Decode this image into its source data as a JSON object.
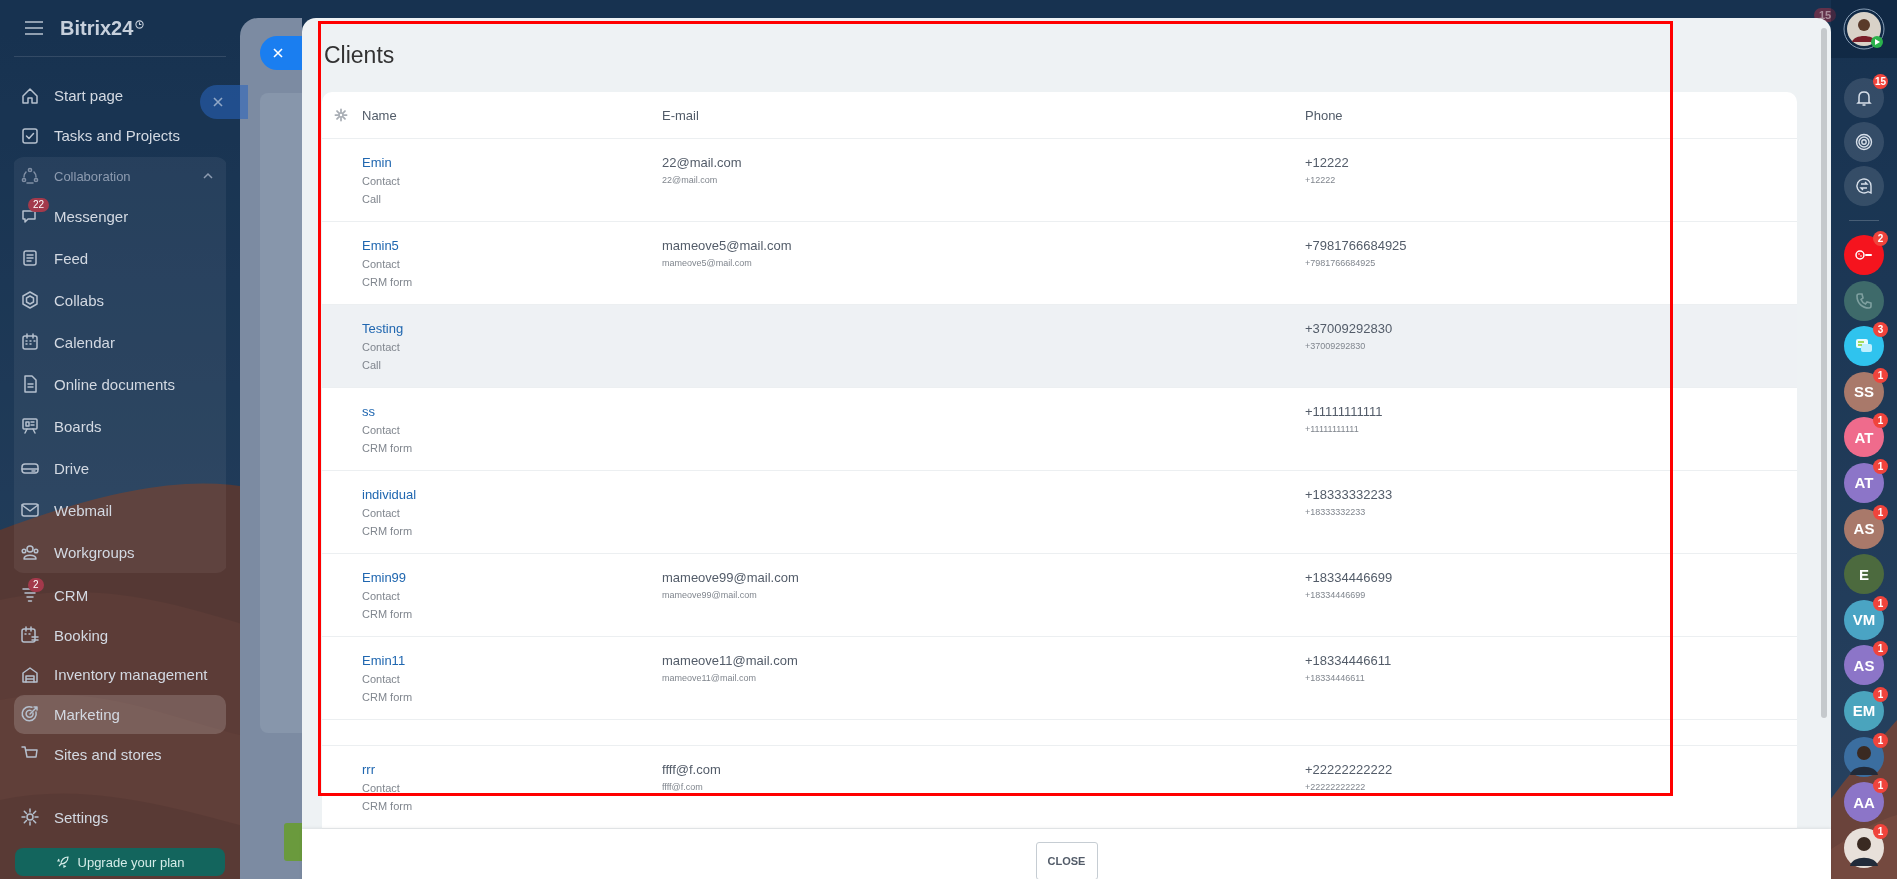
{
  "sidebar": {
    "logo": "Bitrix24",
    "items": [
      {
        "label": "Start page",
        "selected": false
      },
      {
        "label": "Tasks and Projects",
        "selected": false
      },
      {
        "label": "Collaboration",
        "kind": "group",
        "expanded": true,
        "children": [
          {
            "label": "Messenger",
            "badge": "22",
            "selected": false
          },
          {
            "label": "Feed",
            "selected": false
          },
          {
            "label": "Collabs",
            "selected": false
          },
          {
            "label": "Calendar",
            "selected": false
          },
          {
            "label": "Online documents",
            "selected": false
          },
          {
            "label": "Boards",
            "selected": false
          },
          {
            "label": "Drive",
            "selected": false
          },
          {
            "label": "Webmail",
            "selected": false
          },
          {
            "label": "Workgroups",
            "selected": false
          }
        ]
      },
      {
        "label": "CRM",
        "badge": "2",
        "selected": false
      },
      {
        "label": "Booking",
        "selected": false
      },
      {
        "label": "Inventory management",
        "selected": false
      },
      {
        "label": "Marketing",
        "selected": true
      },
      {
        "label": "Sites and stores",
        "selected": false
      }
    ],
    "settings": "Settings",
    "upgrade": "Upgrade your plan"
  },
  "dialog": {
    "title": "Clients",
    "columns": [
      "Name",
      "E-mail",
      "Phone"
    ],
    "rows": [
      {
        "kind": "client",
        "name": "Emin",
        "type": "Contact",
        "source": "Call",
        "email": "22@mail.com",
        "email_caption": "22@mail.com",
        "phone": "+12222",
        "phone_caption": "+12222",
        "hovered": false
      },
      {
        "kind": "client",
        "name": "Emin5",
        "type": "Contact",
        "source": "CRM form",
        "email": "mameove5@mail.com",
        "email_caption": "mameove5@mail.com",
        "phone": "+7981766684925",
        "phone_caption": "+7981766684925",
        "hovered": false
      },
      {
        "kind": "client",
        "name": "Testing",
        "type": "Contact",
        "source": "Call",
        "phone": "+37009292830",
        "phone_caption": "+37009292830",
        "hovered": true
      },
      {
        "kind": "client",
        "name": "ss",
        "type": "Contact",
        "source": "CRM form",
        "phone": "+11111111111",
        "phone_caption": "+11111111111",
        "hovered": false
      },
      {
        "kind": "client",
        "name": "individual",
        "type": "Contact",
        "source": "CRM form",
        "phone": "+18333332233",
        "phone_caption": "+18333332233",
        "hovered": false
      },
      {
        "kind": "client",
        "name": "Emin99",
        "type": "Contact",
        "source": "CRM form",
        "email": "mameove99@mail.com",
        "email_caption": "mameove99@mail.com",
        "phone": "+18334446699",
        "phone_caption": "+18334446699",
        "hovered": false
      },
      {
        "kind": "client",
        "name": "Emin11",
        "type": "Contact",
        "source": "CRM form",
        "email": "mameove11@mail.com",
        "email_caption": "mameove11@mail.com",
        "phone": "+18334446611",
        "phone_caption": "+18334446611",
        "hovered": false
      },
      {
        "kind": "empty"
      },
      {
        "kind": "client",
        "name": "rrr",
        "type": "Contact",
        "source": "CRM form",
        "email": "ffff@f.com",
        "email_caption": "ffff@f.com",
        "phone": "+22222222222",
        "phone_caption": "+22222222222",
        "hovered": false
      }
    ],
    "close": "CLOSE"
  },
  "rightbar": {
    "top_counter": "15",
    "notifications_badge": "15",
    "chats": [
      {
        "kind": "twilio",
        "color": "#f5141e",
        "badge": "2"
      },
      {
        "kind": "phone",
        "color": "#3e6a6a"
      },
      {
        "kind": "chat",
        "color": "#2fc3ee",
        "badge": "3"
      },
      {
        "kind": "initials",
        "initials": "SS",
        "color": "#a9796a",
        "badge": "1"
      },
      {
        "kind": "initials",
        "initials": "AT",
        "color": "#ef6b8c",
        "badge": "1"
      },
      {
        "kind": "initials",
        "initials": "AT",
        "color": "#8c75c8",
        "badge": "1"
      },
      {
        "kind": "initials",
        "initials": "AS",
        "color": "#a9796a",
        "badge": "1"
      },
      {
        "kind": "initials",
        "initials": "E",
        "color": "#4c6a3e"
      },
      {
        "kind": "initials",
        "initials": "VM",
        "color": "#4aa4c4",
        "badge": "1"
      },
      {
        "kind": "initials",
        "initials": "AS",
        "color": "#8c75c8",
        "badge": "1"
      },
      {
        "kind": "initials",
        "initials": "EM",
        "color": "#4aa4bd",
        "badge": "1"
      },
      {
        "color": "#3b6ea0",
        "badge": "1"
      },
      {
        "kind": "initials",
        "initials": "AA",
        "color": "#8c75c8",
        "badge": "1"
      },
      {
        "color": "#e8e0da",
        "badge": "1"
      }
    ]
  }
}
